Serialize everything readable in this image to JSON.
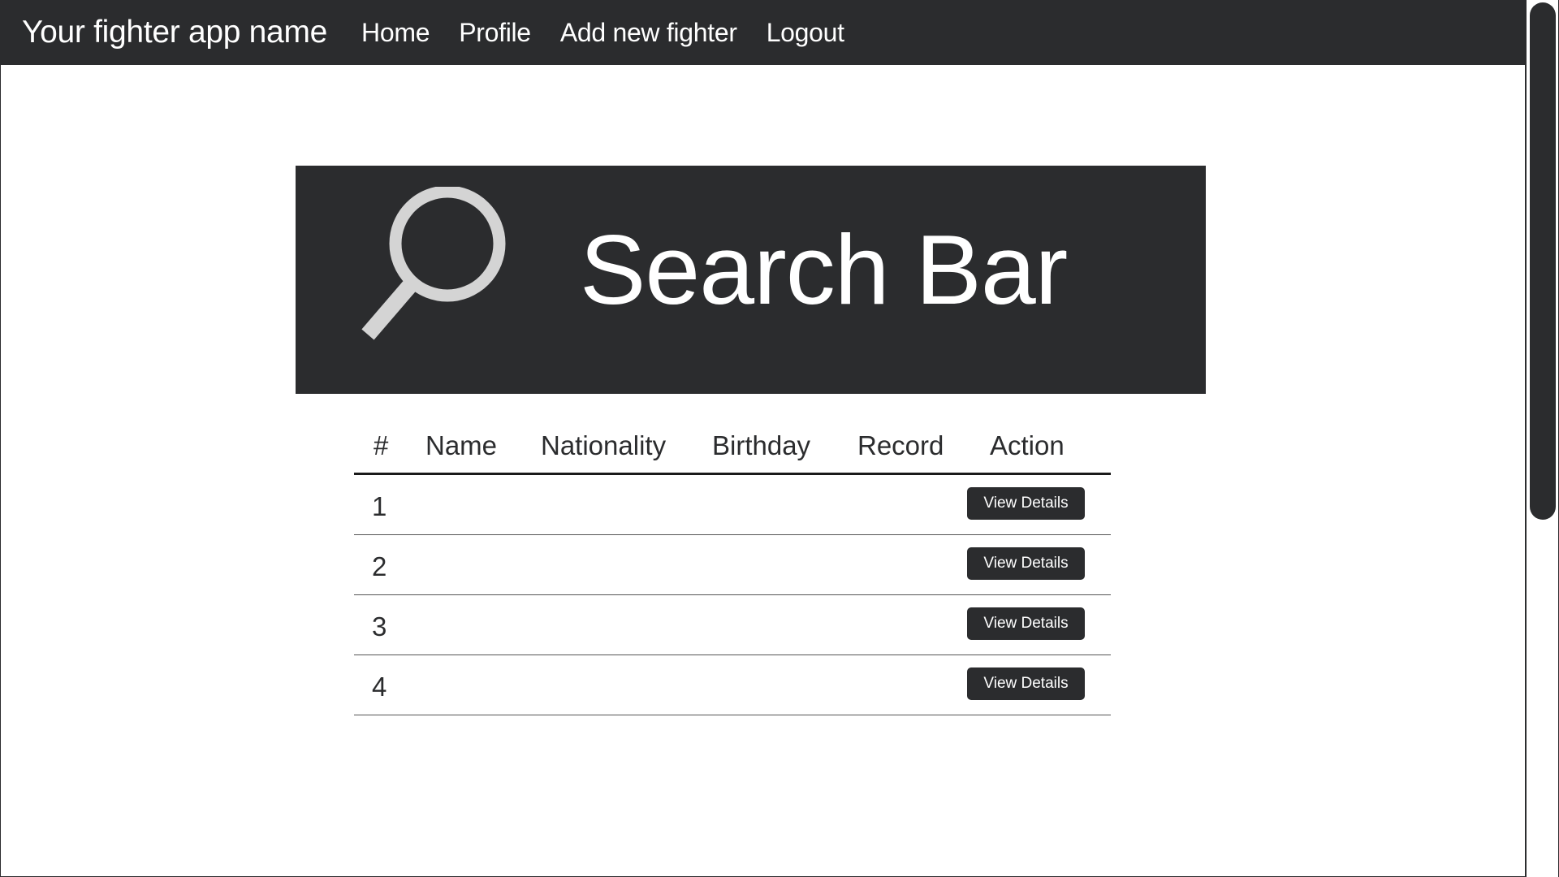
{
  "navbar": {
    "brand": "Your fighter app name",
    "links": [
      "Home",
      "Profile",
      "Add new fighter",
      "Logout"
    ]
  },
  "search": {
    "label": "Search Bar",
    "icon": "search-icon"
  },
  "table": {
    "headers": [
      "#",
      "Name",
      "Nationality",
      "Birthday",
      "Record",
      "Action"
    ],
    "rows": [
      {
        "num": "1",
        "action": "View Details"
      },
      {
        "num": "2",
        "action": "View Details"
      },
      {
        "num": "3",
        "action": "View Details"
      },
      {
        "num": "4",
        "action": "View Details"
      }
    ]
  },
  "colors": {
    "dark": "#2b2c2e",
    "icon": "#d4d4d4",
    "background": "#ffffff"
  }
}
